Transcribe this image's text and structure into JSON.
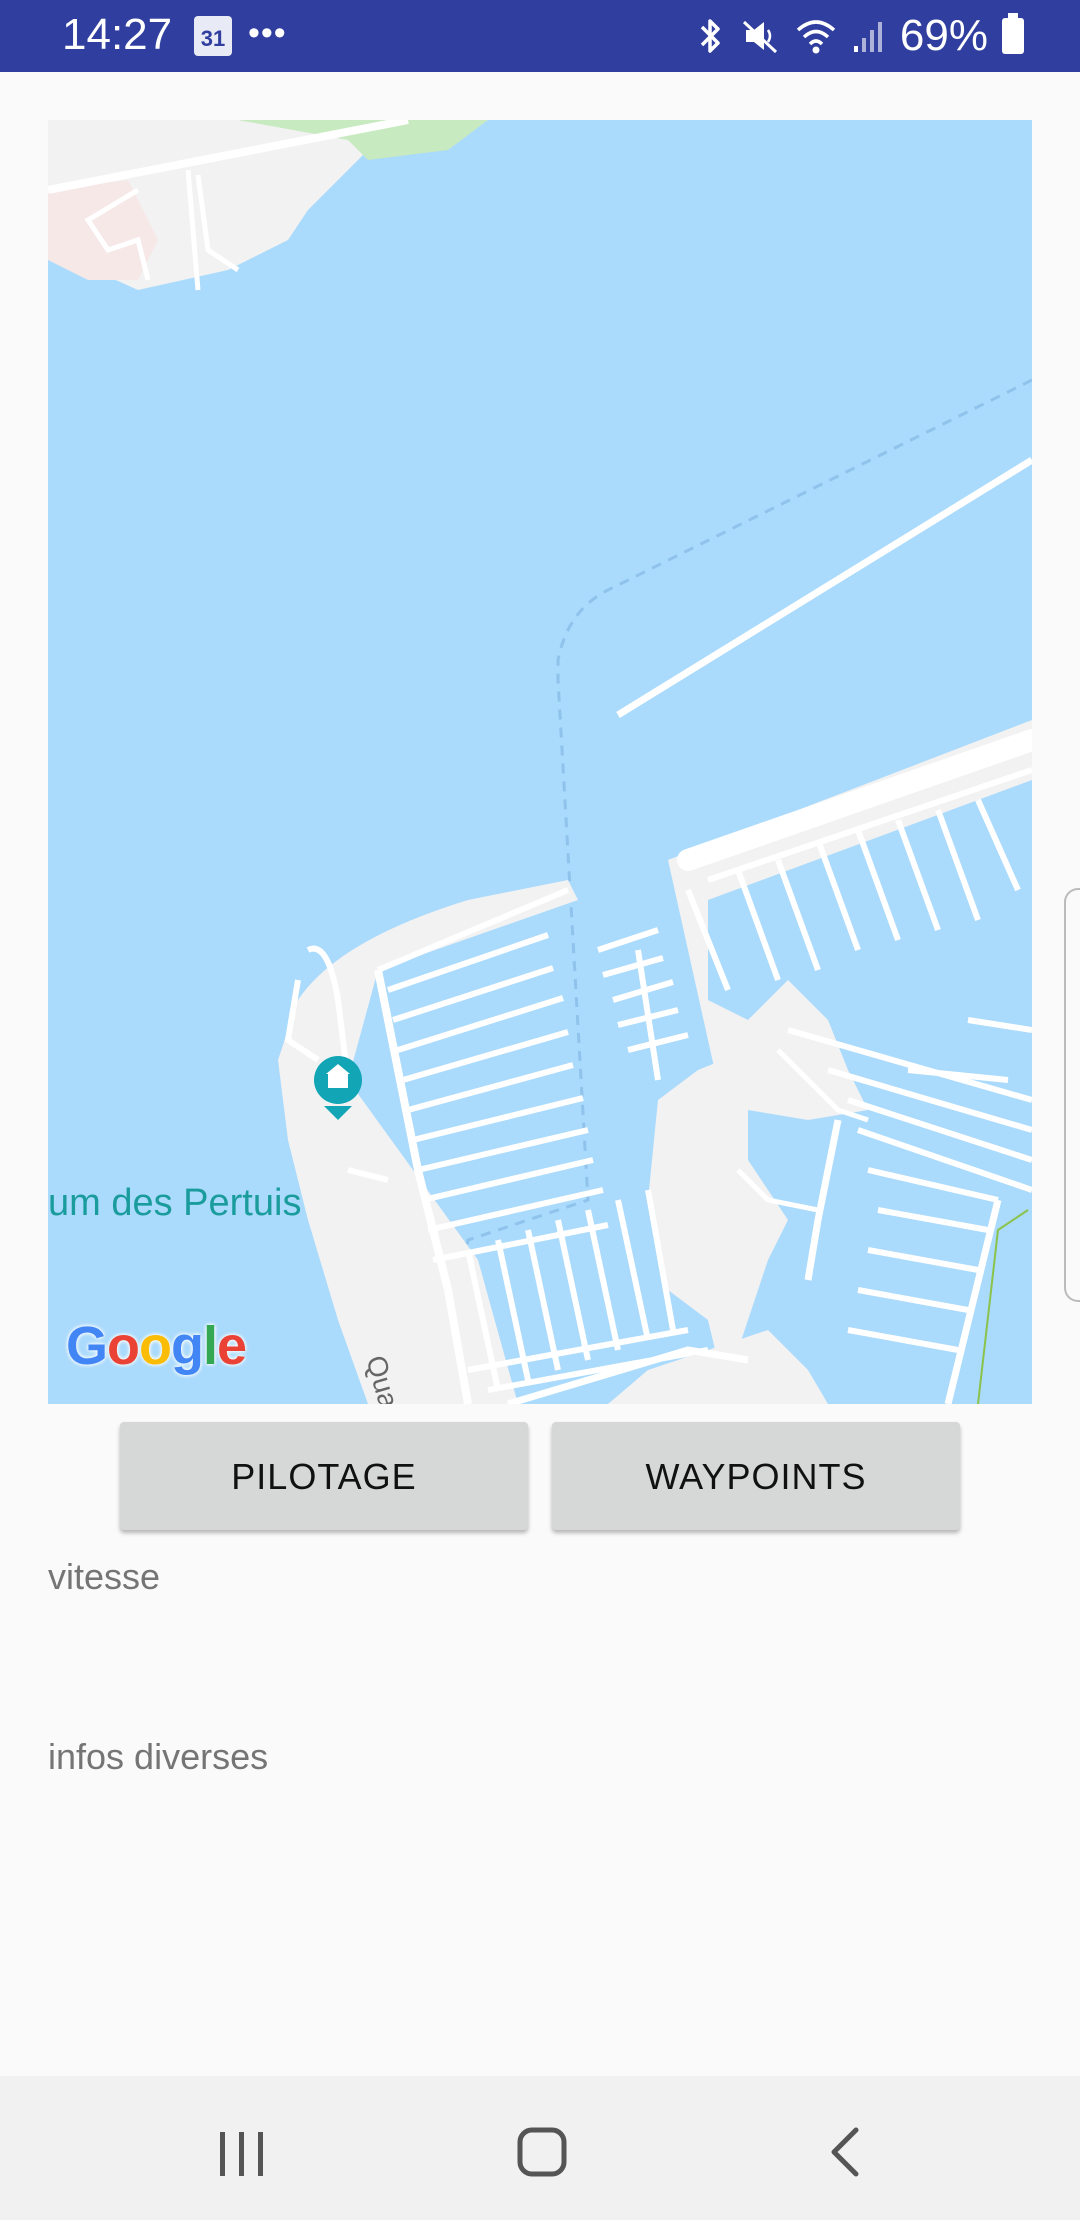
{
  "status_bar": {
    "time": "14:27",
    "calendar_day": "31",
    "notification_more": "•••",
    "battery_percent": "69%",
    "icons": [
      "calendar-icon",
      "bluetooth-icon",
      "mute-icon",
      "wifi-icon",
      "signal-icon",
      "battery-icon"
    ],
    "background_color": "#303f9f"
  },
  "map": {
    "poi_label": "um des Pertuis",
    "road_label": "Quai du Lazaret",
    "attribution": {
      "letters": [
        "G",
        "o",
        "o",
        "g",
        "l",
        "e"
      ]
    },
    "water_color": "#aadafc",
    "land_color": "#f2f2f2"
  },
  "buttons": {
    "pilotage": "PILOTAGE",
    "waypoints": "WAYPOINTS"
  },
  "fields": {
    "vitesse": "vitesse",
    "infos": "infos diverses"
  },
  "navigation": {
    "icons": [
      "recents-icon",
      "home-icon",
      "back-icon"
    ]
  }
}
